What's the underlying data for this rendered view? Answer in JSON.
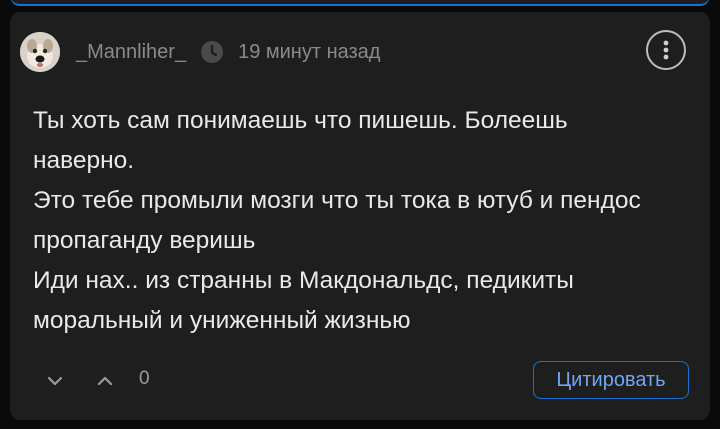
{
  "comment": {
    "username": "_Mannliher_",
    "timestamp": "19 минут назад",
    "lines": [
      "Ты хоть сам понимаешь что пишешь. Болеешь",
      "наверно.",
      "Это тебе промыли мозги что ты тока в ютуб и пендос",
      "пропаганду веришь",
      "Иди нах.. из странны в Макдональдс, педикиты",
      "моральный и униженный жизнью"
    ],
    "vote_count": "0",
    "quote_label": "Цитировать"
  },
  "icons": {
    "clock": "clock-icon",
    "more": "more-vertical-icon",
    "vote_down": "chevron-down-icon",
    "vote_up": "chevron-up-icon"
  },
  "colors": {
    "background": "#0a0a0a",
    "card": "#1e1e1e",
    "text": "#e9e9e9",
    "muted": "#8a8a8a",
    "accent": "#1f6fd6"
  }
}
